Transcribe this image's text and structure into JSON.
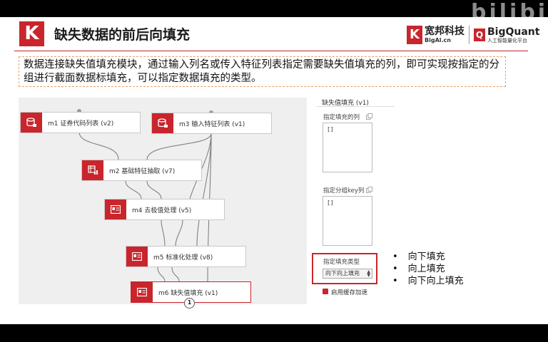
{
  "header": {
    "logo_letter": "K",
    "title": "缺失数据的前后向填充",
    "brand_k": "K",
    "brand_name_cn": "宽邦科技",
    "brand_name_en": "BigAl.cn",
    "brand_q": "Q",
    "brand2_name_en": "BigQuant",
    "brand2_name_cn": "人工智能量化平台"
  },
  "description": "数据连接缺失值填充模块，通过输入列名或传入特征列表指定需要缺失值填充的列，即可实现按指定的分组进行截面数据标填充，可以指定数据填充的类型。",
  "nodes": [
    {
      "label": "m1 证券代码列表 (v2)",
      "icon": "database-list-icon"
    },
    {
      "label": "m3 输入特征列表 (v1)",
      "icon": "database-list-icon"
    },
    {
      "label": "m2 基础特征抽取 (v7)",
      "icon": "table-chart-icon"
    },
    {
      "label": "m4 去极值处理 (v5)",
      "icon": "id-card-icon"
    },
    {
      "label": "m5 标准化处理 (v8)",
      "icon": "id-card-icon"
    },
    {
      "label": "m6 缺失值填充 (v1)",
      "icon": "id-card-icon"
    }
  ],
  "output_port_badge": "1",
  "panel": {
    "title": "缺失值填充 (v1)",
    "fields": [
      {
        "label": "指定填充的列",
        "value": "[]"
      },
      {
        "label": "指定分组key列",
        "value": "[]"
      }
    ],
    "fill_type_label": "指定填充类型",
    "fill_type_value": "向下向上填充",
    "cache_label": "启用缓存加速",
    "cache_checked": true
  },
  "bullets": [
    "向下填充",
    "向上填充",
    "向下向上填充"
  ],
  "watermark": "bilibili",
  "colors": {
    "accent": "#c9252c",
    "canvas_bg": "#efefef",
    "outline": "#e8a26a"
  }
}
